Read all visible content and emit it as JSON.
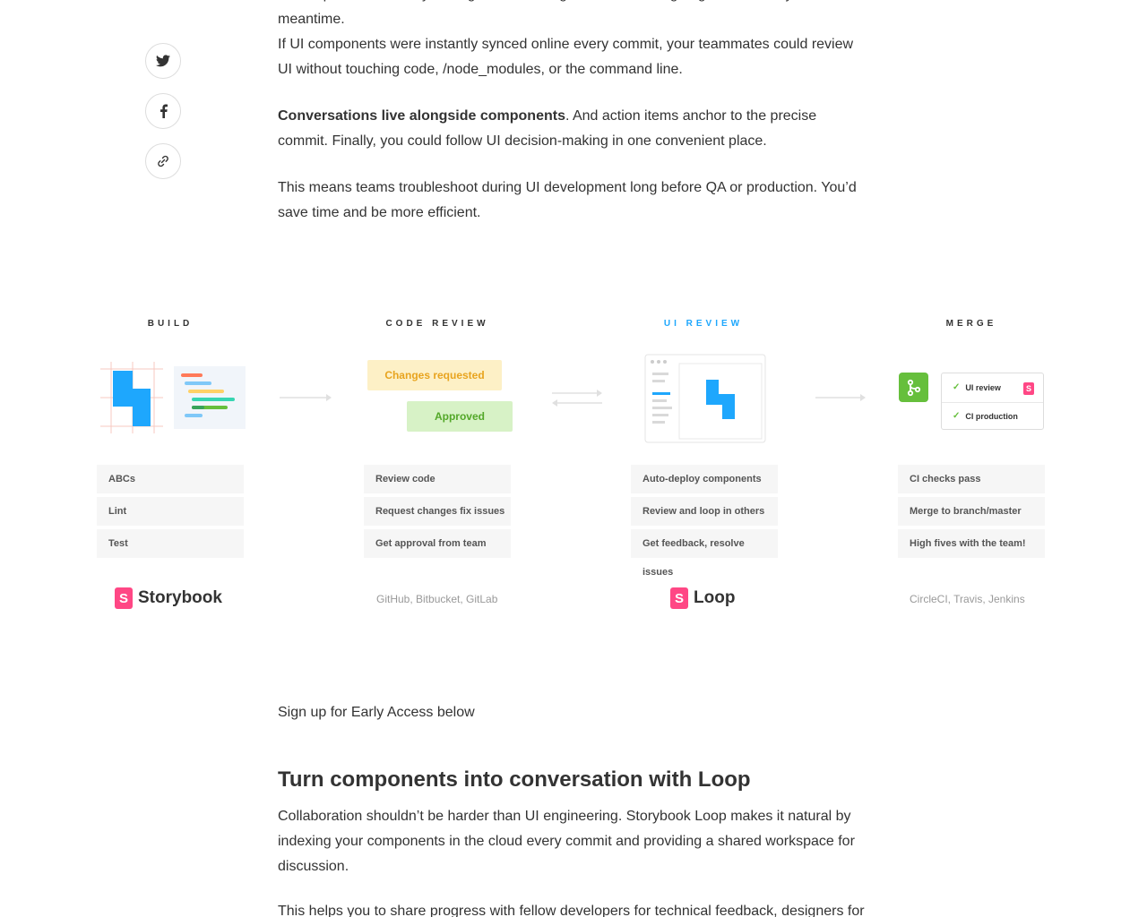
{
  "share": {
    "twitter_icon": "twitter-icon",
    "facebook_icon": "facebook-icon",
    "link_icon": "link-icon"
  },
  "article": {
    "top_cut": "UI components are only testing in isolation right now, so cutting edge consistency exist in the meantime.",
    "p1": "If UI components were instantly synced online every commit, your teammates could review UI without touching code, /node_modules, or the command line.",
    "p2_bold": "Conversations live alongside components",
    "p2_rest": ". And action items anchor to the precise commit. Finally, you could follow UI decision-making in one convenient place.",
    "p3": "This means teams troubleshoot during UI development long before QA or production. You’d save time and be more efficient.",
    "cta": "Sign up for Early Access below",
    "heading": "Turn components into conversation with Loop",
    "p4": "Collaboration shouldn’t be harder than UI engineering. Storybook Loop makes it natural by indexing your components in the cloud every commit and providing a shared workspace for discussion.",
    "p5": "This helps you to share progress with fellow developers for technical feedback, designers for"
  },
  "diagram": {
    "stages": [
      {
        "title": "BUILD",
        "items": [
          "ABCs",
          "Lint",
          "Test"
        ],
        "tool": "Storybook"
      },
      {
        "title": "CODE REVIEW",
        "items": [
          "Review code",
          "Request changes fix issues",
          "Get approval from team"
        ],
        "tool": "GitHub, Bitbucket, GitLab"
      },
      {
        "title": "UI REVIEW",
        "items": [
          "Auto-deploy components",
          "Review and loop in others",
          "Get feedback, resolve issues"
        ],
        "tool": "Loop"
      },
      {
        "title": "MERGE",
        "items": [
          "CI checks pass",
          "Merge to branch/master",
          "High fives with the team!"
        ],
        "tool": "CircleCI, Travis, Jenkins"
      }
    ],
    "code_review_bubbles": {
      "changes": "Changes requested",
      "approved": "Approved"
    },
    "merge_checks": [
      "UI review",
      "CI production"
    ],
    "logo_mark": "S",
    "colors": {
      "accent": "#1ea7fd",
      "storybook_pink": "#ff4785",
      "approved_green": "#66bf3c",
      "changes_yellow": "#e8a41f"
    }
  }
}
